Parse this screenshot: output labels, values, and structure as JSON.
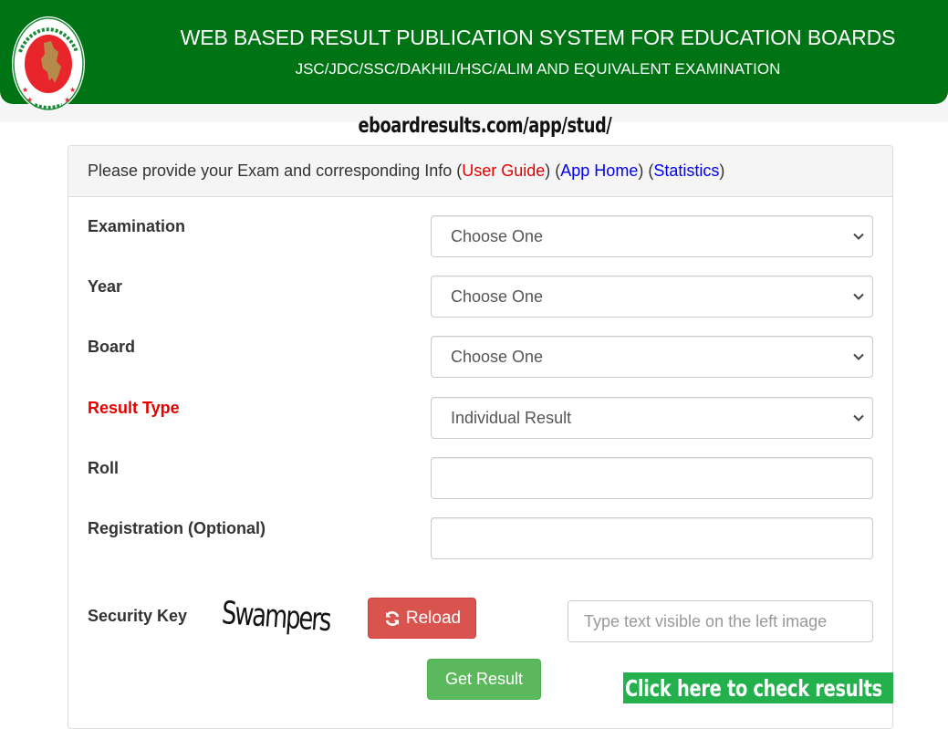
{
  "header": {
    "title": "WEB BASED RESULT PUBLICATION SYSTEM FOR EDUCATION BOARDS",
    "subtitle": "JSC/JDC/SSC/DAKHIL/HSC/ALIM AND EQUIVALENT EXAMINATION",
    "logo": "bangladesh-government-seal-icon",
    "colors": {
      "header_bg": "#007415",
      "seal_red": "#e8252b",
      "map_gold": "#b58a4a"
    }
  },
  "overlay_url": "eboardresults.com/app/stud/",
  "panel": {
    "heading_prefix": "Please provide your Exam and corresponding Info (",
    "links": [
      {
        "label": "User Guide",
        "color": "#e80000"
      },
      {
        "label": "App Home",
        "color": "#0000ee"
      },
      {
        "label": "Statistics",
        "color": "#0000ee"
      }
    ],
    "sep1": ") (",
    "sep2": ") (",
    "suffix": ")"
  },
  "form": {
    "examination": {
      "label": "Examination",
      "selected": "Choose One"
    },
    "year": {
      "label": "Year",
      "selected": "Choose One"
    },
    "board": {
      "label": "Board",
      "selected": "Choose One"
    },
    "result_type": {
      "label": "Result Type",
      "selected": "Individual Result",
      "label_color": "#e80000"
    },
    "roll": {
      "label": "Roll",
      "value": "",
      "placeholder": ""
    },
    "registration": {
      "label": "Registration (Optional)",
      "value": "",
      "placeholder": ""
    },
    "security": {
      "label": "Security Key",
      "captcha_text": "Swampers",
      "reload_label": "Reload",
      "reload_icon": "refresh-icon",
      "input_value": "",
      "input_placeholder": "Type text visible on the left image"
    },
    "submit_label": "Get Result"
  },
  "cta_banner": {
    "label": "Click here to check results",
    "bg": "#23b04d"
  }
}
